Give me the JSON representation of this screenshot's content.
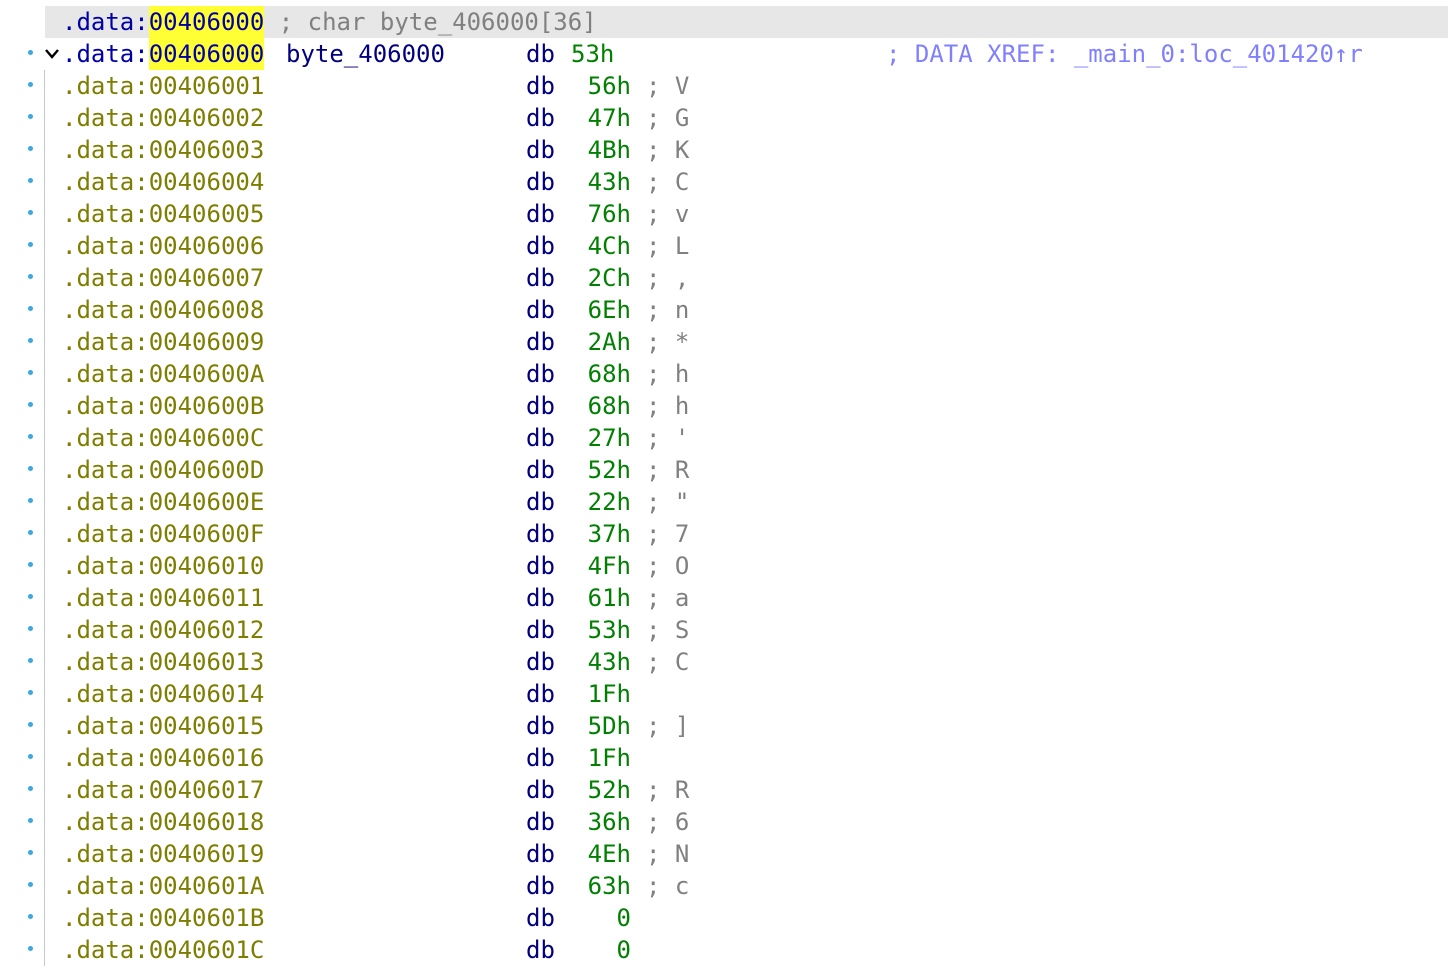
{
  "header_row": {
    "segment": ".data:",
    "address": "00406000",
    "comment": "; char byte_406000[36]"
  },
  "label_row": {
    "segment": ".data:",
    "address": "00406000",
    "name": "byte_406000",
    "mnemonic": "db",
    "value": "53h",
    "xref": "; DATA XREF: _main_0:loc_401420↑r"
  },
  "rows": [
    {
      "addr": ".data:00406001",
      "mn": "db",
      "val": "56h",
      "cmt": "; V"
    },
    {
      "addr": ".data:00406002",
      "mn": "db",
      "val": "47h",
      "cmt": "; G"
    },
    {
      "addr": ".data:00406003",
      "mn": "db",
      "val": "4Bh",
      "cmt": "; K"
    },
    {
      "addr": ".data:00406004",
      "mn": "db",
      "val": "43h",
      "cmt": "; C"
    },
    {
      "addr": ".data:00406005",
      "mn": "db",
      "val": "76h",
      "cmt": "; v"
    },
    {
      "addr": ".data:00406006",
      "mn": "db",
      "val": "4Ch",
      "cmt": "; L"
    },
    {
      "addr": ".data:00406007",
      "mn": "db",
      "val": "2Ch",
      "cmt": "; ,"
    },
    {
      "addr": ".data:00406008",
      "mn": "db",
      "val": "6Eh",
      "cmt": "; n"
    },
    {
      "addr": ".data:00406009",
      "mn": "db",
      "val": "2Ah",
      "cmt": "; *"
    },
    {
      "addr": ".data:0040600A",
      "mn": "db",
      "val": "68h",
      "cmt": "; h"
    },
    {
      "addr": ".data:0040600B",
      "mn": "db",
      "val": "68h",
      "cmt": "; h"
    },
    {
      "addr": ".data:0040600C",
      "mn": "db",
      "val": "27h",
      "cmt": "; '"
    },
    {
      "addr": ".data:0040600D",
      "mn": "db",
      "val": "52h",
      "cmt": "; R"
    },
    {
      "addr": ".data:0040600E",
      "mn": "db",
      "val": "22h",
      "cmt": "; \""
    },
    {
      "addr": ".data:0040600F",
      "mn": "db",
      "val": "37h",
      "cmt": "; 7"
    },
    {
      "addr": ".data:00406010",
      "mn": "db",
      "val": "4Fh",
      "cmt": "; O"
    },
    {
      "addr": ".data:00406011",
      "mn": "db",
      "val": "61h",
      "cmt": "; a"
    },
    {
      "addr": ".data:00406012",
      "mn": "db",
      "val": "53h",
      "cmt": "; S"
    },
    {
      "addr": ".data:00406013",
      "mn": "db",
      "val": "43h",
      "cmt": "; C"
    },
    {
      "addr": ".data:00406014",
      "mn": "db",
      "val": "1Fh",
      "cmt": ""
    },
    {
      "addr": ".data:00406015",
      "mn": "db",
      "val": "5Dh",
      "cmt": "; ]"
    },
    {
      "addr": ".data:00406016",
      "mn": "db",
      "val": "1Fh",
      "cmt": ""
    },
    {
      "addr": ".data:00406017",
      "mn": "db",
      "val": "52h",
      "cmt": "; R"
    },
    {
      "addr": ".data:00406018",
      "mn": "db",
      "val": "36h",
      "cmt": "; 6"
    },
    {
      "addr": ".data:00406019",
      "mn": "db",
      "val": "4Eh",
      "cmt": "; N"
    },
    {
      "addr": ".data:0040601A",
      "mn": "db",
      "val": "63h",
      "cmt": "; c"
    },
    {
      "addr": ".data:0040601B",
      "mn": "db",
      "val": "0",
      "cmt": ""
    },
    {
      "addr": ".data:0040601C",
      "mn": "db",
      "val": "0",
      "cmt": ""
    }
  ],
  "colors": {
    "address": "#7d7d00",
    "address_selected": "#0000a8",
    "mnemonic": "#000080",
    "value": "#008000",
    "comment": "#808080",
    "xref": "#8080ff",
    "highlight": "#ffff33",
    "gutter_dot": "#3aa7e0"
  },
  "icons": {
    "collapse": "chevron-down-icon",
    "row_marker": "bullet-dot-icon"
  }
}
